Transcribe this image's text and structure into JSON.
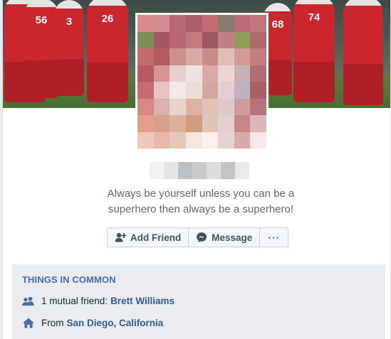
{
  "profile": {
    "bio_line1": "Always be yourself unless you can be a",
    "bio_line2": "superhero then always be a superhero!"
  },
  "cover": {
    "jersey_numbers": [
      "56",
      "3",
      "26",
      "68",
      "74"
    ]
  },
  "actions": {
    "add_friend_label": "Add Friend",
    "message_label": "Message",
    "more_label": "···"
  },
  "things_in_common": {
    "title": "THINGS IN COMMON",
    "mutual_prefix": "1 mutual friend:",
    "mutual_name": "Brett Williams",
    "from_prefix": "From",
    "from_place": "San Diego, California"
  },
  "colors": {
    "link": "#365899",
    "section_title": "#4b6ba5",
    "jersey_red": "#c9262e"
  },
  "icons": {
    "add_friend": "person-plus-icon",
    "message": "messenger-icon",
    "mutual": "people-icon",
    "from": "home-icon"
  }
}
